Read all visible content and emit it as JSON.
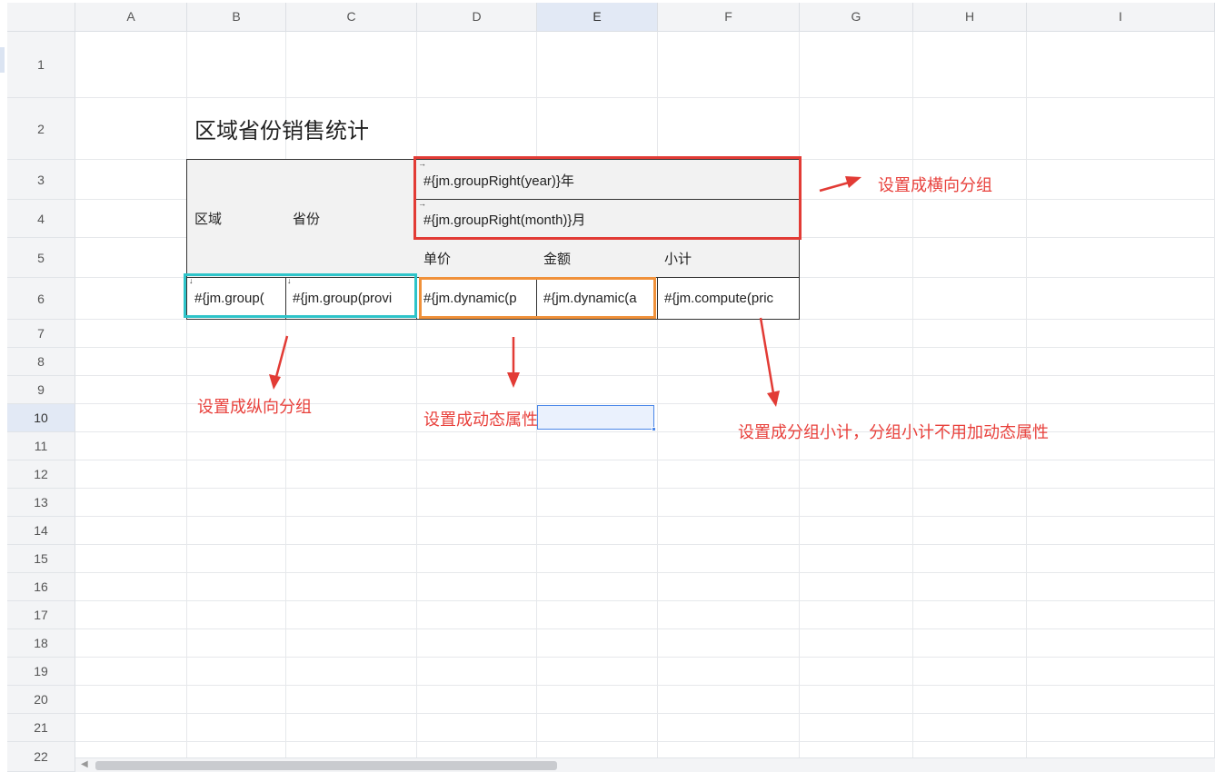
{
  "columns": [
    "A",
    "B",
    "C",
    "D",
    "E",
    "F",
    "G",
    "H",
    "I"
  ],
  "selected_column": "E",
  "rows": [
    "1",
    "2",
    "3",
    "4",
    "5",
    "6",
    "7",
    "8",
    "9",
    "10",
    "11",
    "12",
    "13",
    "14",
    "15",
    "16",
    "17",
    "18",
    "19",
    "20",
    "21",
    "22"
  ],
  "selected_row": "10",
  "sheet": {
    "title": "区域省份销售统计",
    "header_region": "区域",
    "header_province": "省份",
    "header_year": "#{jm.groupRight(year)}年",
    "header_month": "#{jm.groupRight(month)}月",
    "header_unit_price": "单价",
    "header_amount": "金额",
    "header_subtotal": "小计",
    "cell_b6": "#{jm.group(",
    "cell_c6": "#{jm.group(provi",
    "cell_d6": "#{jm.dynamic(p",
    "cell_e6": "#{jm.dynamic(a",
    "cell_f6": "#{jm.compute(pric",
    "arrow_right_glyph": "→",
    "arrow_down_glyph": "↓"
  },
  "annotations": {
    "horizontal_group": "设置成横向分组",
    "vertical_group": "设置成纵向分组",
    "dynamic_attr": "设置成动态属性",
    "subtotal": "设置成分组小计，分组小计不用加动态属性"
  },
  "colors": {
    "annotation_red": "#e8413c",
    "group_cyan": "#2ec4c9",
    "dynamic_orange": "#f0913a",
    "selection_blue": "#4a86e8"
  },
  "icons": {
    "scroll_left": "chevron-left-icon"
  }
}
